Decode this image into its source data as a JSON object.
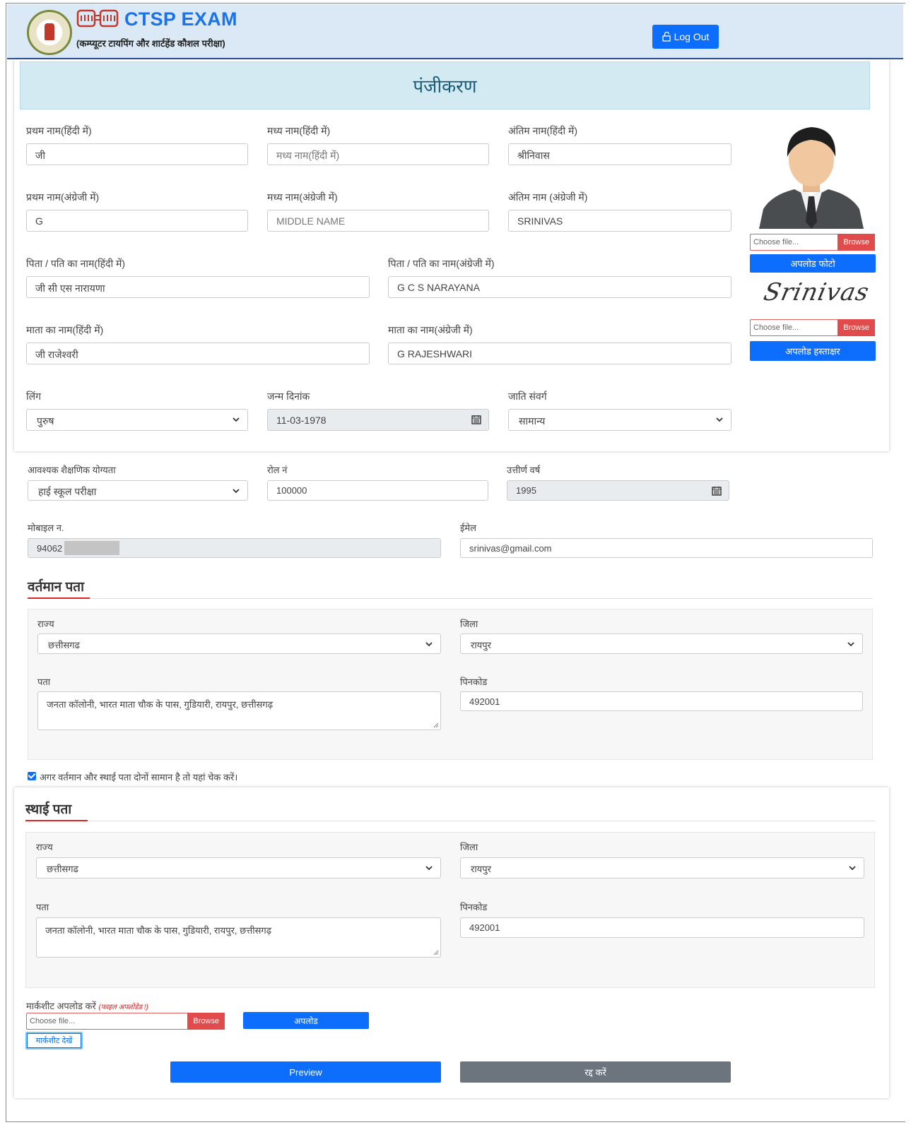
{
  "header": {
    "brand": "CTSP EXAM",
    "subtitle": "(कम्प्यूटर टायपिंग और शार्टहेंड कौशल परीक्षा)",
    "logout_label": "Log Out"
  },
  "page_title": "पंजीकरण",
  "name_fields": [
    {
      "label": "प्रथम नाम(हिंदी में)",
      "value": "जी"
    },
    {
      "label": "मध्य नाम(हिंदी में)",
      "placeholder": "मध्य नाम(हिंदी में)"
    },
    {
      "label": "अंतिम नाम(हिंदी में)",
      "value": "श्रीनिवास"
    },
    {
      "label": "प्रथम नाम(अंग्रेजी में)",
      "value": "G"
    },
    {
      "label": "मध्य नाम(अंग्रेजी में)",
      "placeholder": "MIDDLE NAME"
    },
    {
      "label": "अंतिम नाम (अंग्रेजी में)",
      "value": "SRINIVAS"
    }
  ],
  "father": {
    "hi_label": "पिता / पति का नाम(हिंदी में)",
    "hi_value": "जी सी एस नारायणा",
    "en_label": "पिता / पति का नाम(अंग्रेजी में)",
    "en_value": "G C S NARAYANA"
  },
  "mother": {
    "hi_label": "माता का नाम(हिंदी में)",
    "hi_value": "जी राजेश्वरी",
    "en_label": "माता का नाम(अंग्रेजी में)",
    "en_value": "G RAJESHWARI"
  },
  "gender": {
    "label": "लिंग",
    "value": "पुरुष"
  },
  "dob": {
    "label": "जन्म दिनांक",
    "value": "11-03-1978"
  },
  "caste": {
    "label": "जाति संवर्ग",
    "value": "सामान्य"
  },
  "photo": {
    "file_placeholder": "Choose file...",
    "browse": "Browse",
    "upload_label": "अपलोड फोटो"
  },
  "signature": {
    "text": "Srinivas",
    "file_placeholder": "Choose file...",
    "browse": "Browse",
    "upload_label": "अपलोड हस्ताक्षर"
  },
  "qualification": {
    "label": "आवश्यक शैक्षणिक योग्यता",
    "value": "हाई स्कूल परीक्षा"
  },
  "roll": {
    "label": "रोल नं",
    "value": "100000"
  },
  "passing_year": {
    "label": "उत्तीर्ण वर्ष",
    "value": "1995"
  },
  "mobile": {
    "label": "मोबाइल न.",
    "value": "94062"
  },
  "email": {
    "label": "ईमेल",
    "value": "srinivas@gmail.com"
  },
  "current_address": {
    "title": "वर्तमान पता",
    "state_label": "राज्य",
    "state": "छत्तीसगढ",
    "district_label": "जिला",
    "district": "रायपुर",
    "address_label": "पता",
    "address": "जनता कॉलोनी, भारत माता चौक के पास, गुडियारी, रायपुर, छत्तीसगढ़",
    "pin_label": "पिनकोड",
    "pin": "492001"
  },
  "same_address_check": "अगर वर्तमान और स्थाई पता दोनों सामान है तो यहां चेक करें।",
  "permanent_address": {
    "title": "स्थाई पता",
    "state_label": "राज्य",
    "state": "छत्तीसगढ",
    "district_label": "जिला",
    "district": "रायपुर",
    "address_label": "पता",
    "address": "जनता कॉलोनी, भारत माता चौक के पास, गुडियारी, रायपुर, छत्तीसगढ़",
    "pin_label": "पिनकोड",
    "pin": "492001"
  },
  "marksheet": {
    "label": "मार्कशीट अपलोड करें",
    "status": "(फाइल अपलोडेड !)",
    "file_placeholder": "Choose file...",
    "browse": "Browse",
    "upload_label": "अपलोड",
    "view_label": "मार्कशीट देखें"
  },
  "actions": {
    "preview": "Preview",
    "cancel": "रद्द करें"
  },
  "colors": {
    "primary": "#0d6efd",
    "danger": "#e24b4b",
    "secondary": "#6c757d",
    "header_bg": "#dbe9f7",
    "banner_bg": "#d4eaf2"
  }
}
